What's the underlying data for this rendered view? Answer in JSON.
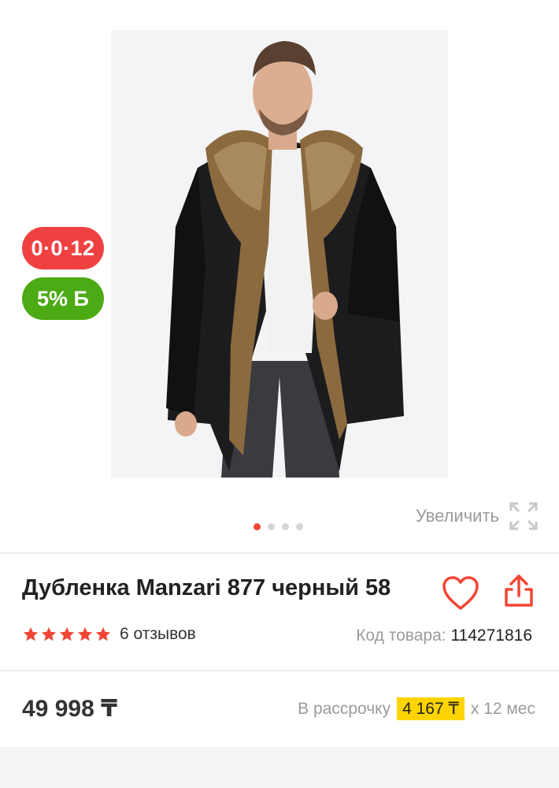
{
  "gallery": {
    "badges": {
      "installment": "0·0·12",
      "bonus": "5% Б"
    },
    "zoom_label": "Увеличить",
    "zoom_icon": "expand-arrows-icon",
    "slides_count": 4,
    "active_slide": 1
  },
  "product": {
    "title": "Дубленка Manzari 877 черный 58",
    "rating": 5,
    "reviews": "6 отзывов",
    "sku_label": "Код товара:",
    "sku_value": "114271816",
    "favorite_icon": "heart-icon",
    "share_icon": "share-icon"
  },
  "pricing": {
    "price": "49 998 ₸",
    "installment_prefix": "В рассрочку",
    "installment_amount": "4 167 ₸",
    "installment_suffix": "х 12 мес"
  },
  "colors": {
    "accent": "#f14635",
    "installment_badge": "#f04141",
    "bonus_badge": "#4caa14",
    "highlight": "#ffd400"
  }
}
